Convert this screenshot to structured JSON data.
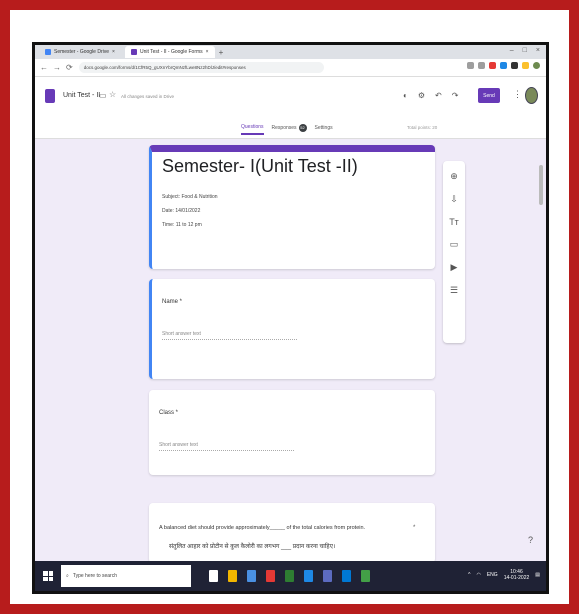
{
  "browser": {
    "tabs": [
      {
        "label": "Semester - Google Drive",
        "close": "×",
        "fav_color": "#4285f4"
      },
      {
        "label": "Unit Test - II - Google Forms",
        "close": "×",
        "fav_color": "#673ab7"
      }
    ],
    "new_tab": "+",
    "window_controls": [
      "–",
      "□",
      "×"
    ],
    "nav": [
      "←",
      "→",
      "⟳"
    ],
    "url": "docs.google.com/forms/d/1CfR5Q_gUXnYbrQmNzfLwe8Nz2hDlJ/edit#responses"
  },
  "form_header": {
    "doc_title": "Unit Test - II",
    "saved_text": "All changes saved in Drive",
    "header_icons": [
      "◐",
      "⚙",
      "↶",
      "↷"
    ],
    "send_label": "Send",
    "more_icon": "⋮",
    "tabs": [
      {
        "label": "Questions",
        "active": true
      },
      {
        "label": "Responses",
        "active": false
      },
      {
        "label": "Settings",
        "active": false
      }
    ],
    "responses_count": "52",
    "total_points": "Total points: 20"
  },
  "form": {
    "title": "Semester- I(Unit Test -II)",
    "description_lines": [
      "Subject: Food & Nutrition",
      "Date: 14/01/2022",
      "Time: 11 to 12 pm"
    ],
    "questions": [
      {
        "label": "Name *",
        "placeholder": "Short answer text"
      },
      {
        "label": "Class *",
        "placeholder": "Short answer text"
      }
    ],
    "q3_text": "A balanced diet should provide approximately_____ of the total calories from protein.",
    "q3_text_hindi": "संतुलित आहार को प्रोटीन से कुल कैलोरी का लगभग ___ प्रदान करना चाहिए।",
    "q3_marker": "*"
  },
  "floatbar_icons": [
    "⊕",
    "⇩",
    "Tт",
    "▭",
    "▶",
    "☰"
  ],
  "fab_icon": "?",
  "taskbar": {
    "search_placeholder": "Type here to search",
    "apps": [
      {
        "color": "#ffffff"
      },
      {
        "color": "#f2b600"
      },
      {
        "color": "#4a90e2"
      },
      {
        "color": "#e53935"
      },
      {
        "color": "#2e7d32"
      },
      {
        "color": "#1e88e5"
      },
      {
        "color": "#5c6bc0"
      },
      {
        "color": "#0078d4"
      },
      {
        "color": "#43a047"
      }
    ],
    "tray_temp": "ENG",
    "time": "10:46",
    "date": "14-01-2022"
  },
  "colors": {
    "frame": "#b71c1c",
    "forms_accent": "#673ab7",
    "active_card": "#4285f4"
  }
}
